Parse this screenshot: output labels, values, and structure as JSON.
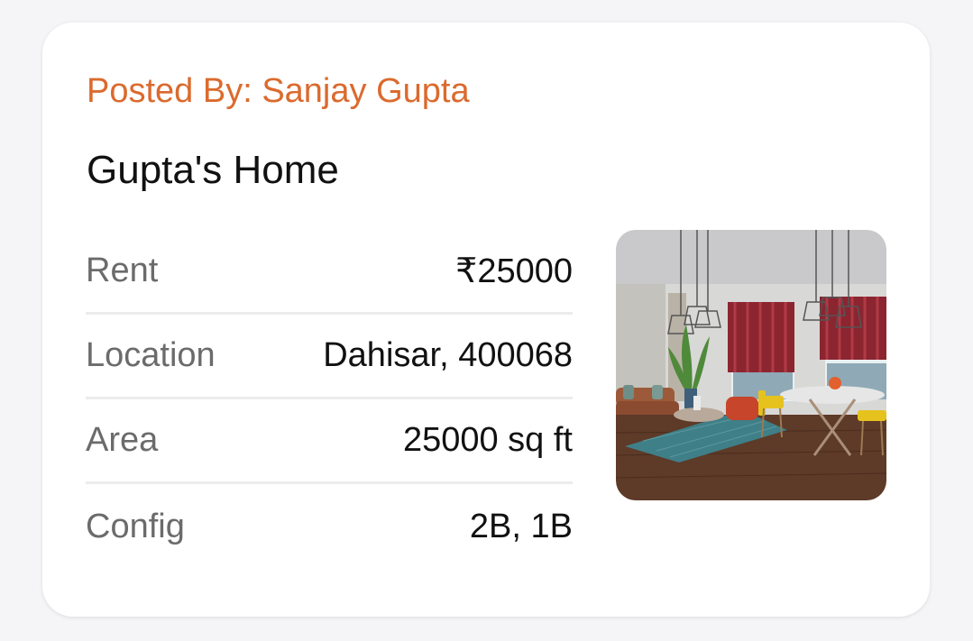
{
  "listing": {
    "posted_by": "Posted By: Sanjay Gupta",
    "title": "Gupta's Home",
    "details": [
      {
        "label": "Rent",
        "value": "₹25000"
      },
      {
        "label": "Location",
        "value": "Dahisar, 400068"
      },
      {
        "label": "Area",
        "value": "25000 sq ft"
      },
      {
        "label": "Config",
        "value": "2B, 1B"
      }
    ],
    "photo": {
      "icon": "living-room-photo"
    }
  },
  "colors": {
    "accent": "#db6a2e",
    "card_bg": "#ffffff",
    "page_bg": "#f5f5f7",
    "label": "#6b6b6b",
    "value": "#111111"
  }
}
